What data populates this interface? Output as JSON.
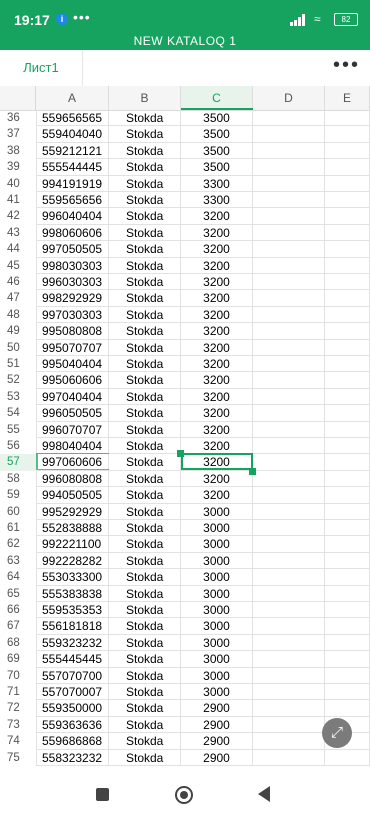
{
  "status_bar": {
    "time": "19:17",
    "notification_badge": "⚓",
    "more": "•••",
    "battery": "82"
  },
  "document": {
    "title": "NEW KATALOQ 1"
  },
  "sheet": {
    "tab_label": "Лист1",
    "menu_icon": "more-vertical-icon",
    "more_label": "•••"
  },
  "columns": [
    "A",
    "B",
    "C",
    "D",
    "E"
  ],
  "selection": {
    "cell": "C57",
    "row": 57,
    "column": "C"
  },
  "rows": [
    {
      "num": "36",
      "a": "559656565",
      "b": "Stokda",
      "c": "3500"
    },
    {
      "num": "37",
      "a": "559404040",
      "b": "Stokda",
      "c": "3500"
    },
    {
      "num": "38",
      "a": "559212121",
      "b": "Stokda",
      "c": "3500"
    },
    {
      "num": "39",
      "a": "555544445",
      "b": "Stokda",
      "c": "3500"
    },
    {
      "num": "40",
      "a": "994191919",
      "b": "Stokda",
      "c": "3300"
    },
    {
      "num": "41",
      "a": "559565656",
      "b": "Stokda",
      "c": "3300"
    },
    {
      "num": "42",
      "a": "996040404",
      "b": "Stokda",
      "c": "3200"
    },
    {
      "num": "43",
      "a": "998060606",
      "b": "Stokda",
      "c": "3200"
    },
    {
      "num": "44",
      "a": "997050505",
      "b": "Stokda",
      "c": "3200"
    },
    {
      "num": "45",
      "a": "998030303",
      "b": "Stokda",
      "c": "3200"
    },
    {
      "num": "46",
      "a": "996030303",
      "b": "Stokda",
      "c": "3200"
    },
    {
      "num": "47",
      "a": "998292929",
      "b": "Stokda",
      "c": "3200"
    },
    {
      "num": "48",
      "a": "997030303",
      "b": "Stokda",
      "c": "3200"
    },
    {
      "num": "49",
      "a": "995080808",
      "b": "Stokda",
      "c": "3200"
    },
    {
      "num": "50",
      "a": "995070707",
      "b": "Stokda",
      "c": "3200"
    },
    {
      "num": "51",
      "a": "995040404",
      "b": "Stokda",
      "c": "3200"
    },
    {
      "num": "52",
      "a": "995060606",
      "b": "Stokda",
      "c": "3200"
    },
    {
      "num": "53",
      "a": "997040404",
      "b": "Stokda",
      "c": "3200"
    },
    {
      "num": "54",
      "a": "996050505",
      "b": "Stokda",
      "c": "3200"
    },
    {
      "num": "55",
      "a": "996070707",
      "b": "Stokda",
      "c": "3200"
    },
    {
      "num": "56",
      "a": "998040404",
      "b": "Stokda",
      "c": "3200"
    },
    {
      "num": "57",
      "a": "997060606",
      "b": "Stokda",
      "c": "3200"
    },
    {
      "num": "58",
      "a": "996080808",
      "b": "Stokda",
      "c": "3200"
    },
    {
      "num": "59",
      "a": "994050505",
      "b": "Stokda",
      "c": "3200"
    },
    {
      "num": "60",
      "a": "995292929",
      "b": "Stokda",
      "c": "3000"
    },
    {
      "num": "61",
      "a": "552838888",
      "b": "Stokda",
      "c": "3000"
    },
    {
      "num": "62",
      "a": "992221100",
      "b": "Stokda",
      "c": "3000"
    },
    {
      "num": "63",
      "a": "992228282",
      "b": "Stokda",
      "c": "3000"
    },
    {
      "num": "64",
      "a": "553033300",
      "b": "Stokda",
      "c": "3000"
    },
    {
      "num": "65",
      "a": "555383838",
      "b": "Stokda",
      "c": "3000"
    },
    {
      "num": "66",
      "a": "559535353",
      "b": "Stokda",
      "c": "3000"
    },
    {
      "num": "67",
      "a": "556181818",
      "b": "Stokda",
      "c": "3000"
    },
    {
      "num": "68",
      "a": "559323232",
      "b": "Stokda",
      "c": "3000"
    },
    {
      "num": "69",
      "a": "555445445",
      "b": "Stokda",
      "c": "3000"
    },
    {
      "num": "70",
      "a": "557070700",
      "b": "Stokda",
      "c": "3000"
    },
    {
      "num": "71",
      "a": "557070007",
      "b": "Stokda",
      "c": "3000"
    },
    {
      "num": "72",
      "a": "559350000",
      "b": "Stokda",
      "c": "2900"
    },
    {
      "num": "73",
      "a": "559363636",
      "b": "Stokda",
      "c": "2900"
    },
    {
      "num": "74",
      "a": "559686868",
      "b": "Stokda",
      "c": "2900"
    },
    {
      "num": "75",
      "a": "558323232",
      "b": "Stokda",
      "c": "2900"
    }
  ],
  "fab": {
    "icon": "expand-icon"
  },
  "navbar": {
    "recents": "recents-icon",
    "home": "home-icon",
    "back": "back-icon"
  }
}
